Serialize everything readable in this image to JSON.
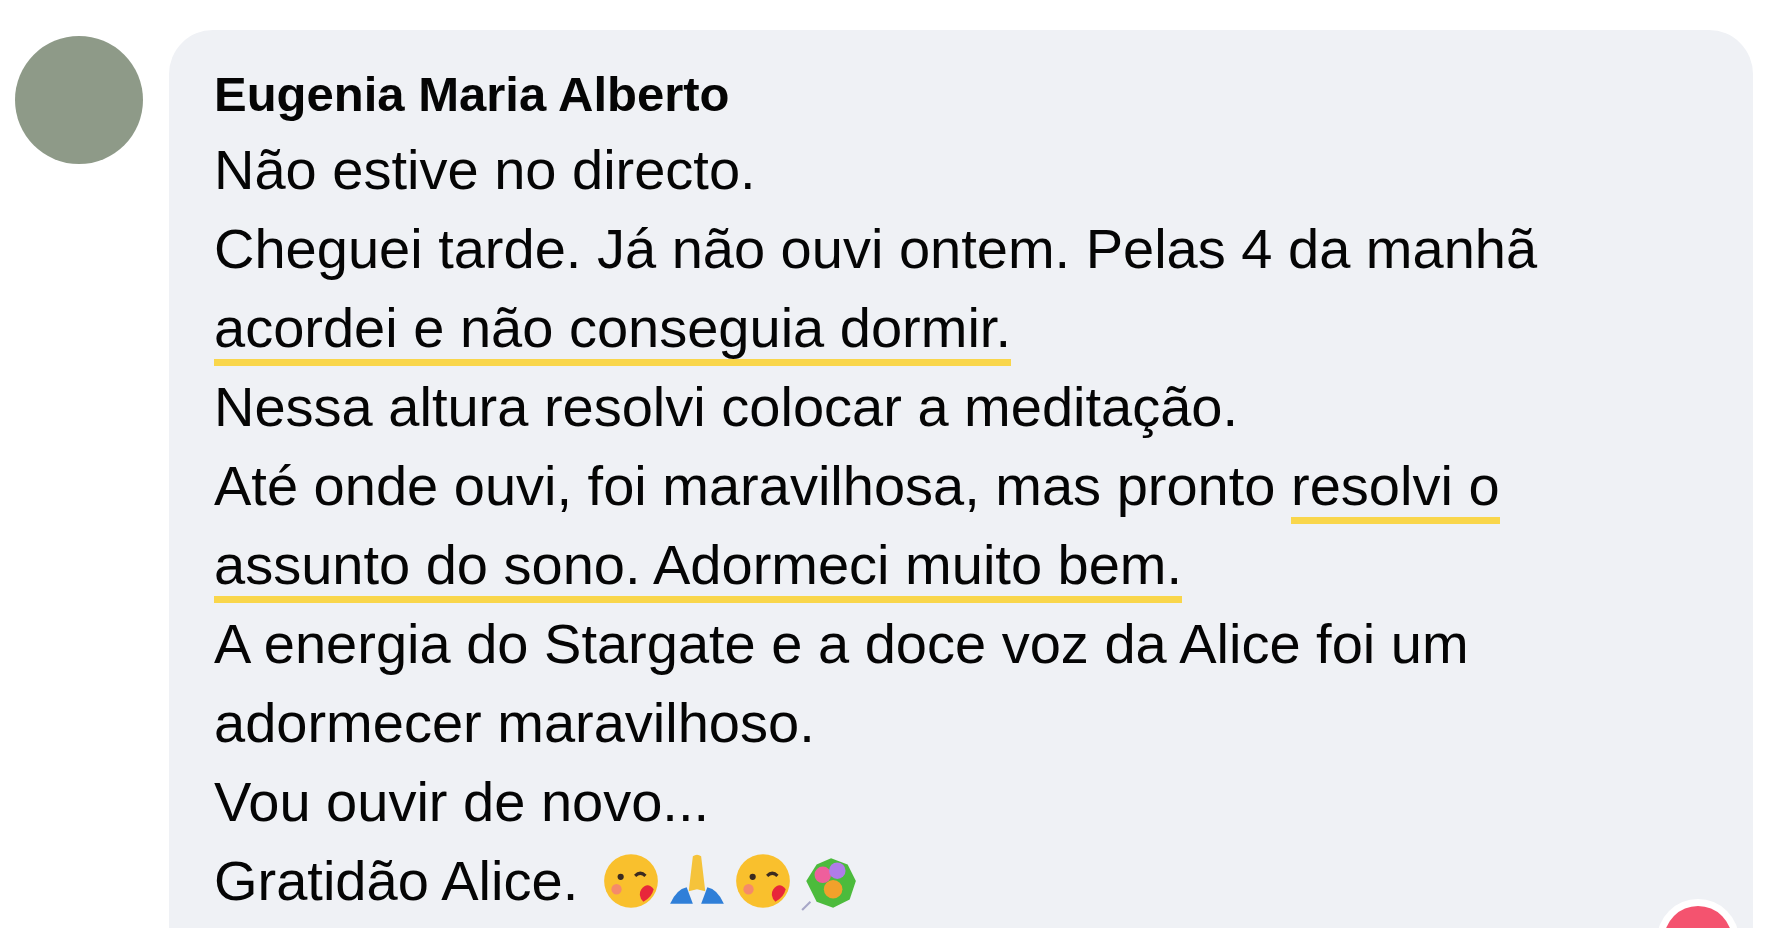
{
  "comment": {
    "author": "Eugenia Maria Alberto",
    "lines": [
      [
        {
          "text": "Não estive no directo.",
          "highlighted": false
        }
      ],
      [
        {
          "text": "Cheguei tarde. Já não ouvi ontem. Pelas 4 da manhã",
          "highlighted": false
        }
      ],
      [
        {
          "text": "acordei e não conseguia dormir.",
          "highlighted": true
        }
      ],
      [
        {
          "text": "Nessa altura resolvi colocar a meditação.",
          "highlighted": false
        }
      ],
      [
        {
          "text": "Até onde ouvi, foi maravilhosa, mas pronto ",
          "highlighted": false
        },
        {
          "text": "resolvi o",
          "highlighted": true
        }
      ],
      [
        {
          "text": "assunto do sono. Adormeci muito bem.",
          "highlighted": true
        }
      ],
      [
        {
          "text": "A energia do Stargate e a doce voz da Alice foi um",
          "highlighted": false
        }
      ],
      [
        {
          "text": "adormecer maravilhoso.",
          "highlighted": false
        }
      ],
      [
        {
          "text": "Vou ouvir de novo...",
          "highlighted": false
        }
      ],
      [
        {
          "text": "Gratidão Alice.",
          "highlighted": false
        }
      ]
    ],
    "emojis": [
      {
        "kind": "kiss"
      },
      {
        "kind": "pray"
      },
      {
        "kind": "kiss"
      },
      {
        "kind": "bouquet"
      }
    ]
  }
}
